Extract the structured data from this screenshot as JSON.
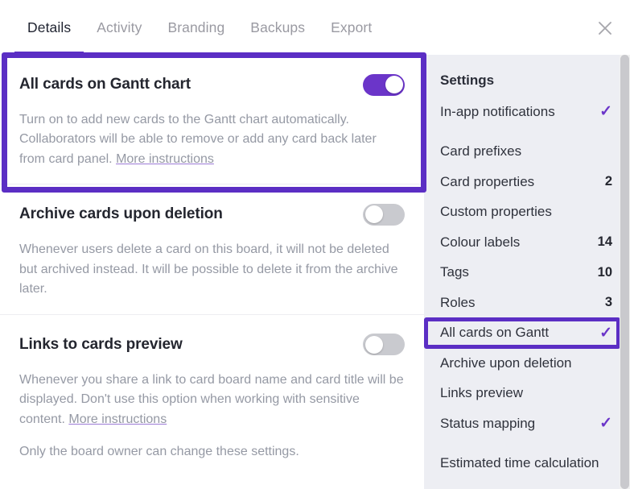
{
  "header": {
    "tabs": [
      {
        "label": "Details",
        "active": true
      },
      {
        "label": "Activity",
        "active": false
      },
      {
        "label": "Branding",
        "active": false
      },
      {
        "label": "Backups",
        "active": false
      },
      {
        "label": "Export",
        "active": false
      }
    ],
    "close_icon": "close-icon",
    "accent_color": "#5b2ec4"
  },
  "main": {
    "sections": [
      {
        "title": "All cards on Gantt chart",
        "body": "Turn on to add new cards to the Gantt chart automatically. Collaborators will be able to remove or add any card back later from card panel. ",
        "link": "More instructions",
        "toggle_state": "on",
        "highlighted": true
      },
      {
        "title": "Archive cards upon deletion",
        "body": "Whenever users delete a card on this board, it will not be deleted but archived instead. It will be possible to delete it from the archive later.",
        "link": "",
        "toggle_state": "off",
        "highlighted": false
      },
      {
        "title": "Links to cards preview",
        "body": "Whenever you share a link to card board name and card title will be displayed. Don't use this option when working with sensitive content. ",
        "link": "More instructions",
        "note": "Only the board owner can change these settings.",
        "toggle_state": "off",
        "highlighted": false
      }
    ]
  },
  "sidebar": {
    "heading": "Settings",
    "check_color": "#6b35c9",
    "items": [
      {
        "label": "In-app notifications",
        "check": "✓",
        "count": ""
      },
      {
        "label": "Card prefixes",
        "check": "",
        "count": "",
        "gap": true
      },
      {
        "label": "Card properties",
        "check": "",
        "count": "2"
      },
      {
        "label": "Custom properties",
        "check": "",
        "count": ""
      },
      {
        "label": "Colour labels",
        "check": "",
        "count": "14"
      },
      {
        "label": "Tags",
        "check": "",
        "count": "10"
      },
      {
        "label": "Roles",
        "check": "",
        "count": "3"
      },
      {
        "label": "All cards on Gantt",
        "check": "✓",
        "count": "",
        "highlighted": true
      },
      {
        "label": "Archive upon deletion",
        "check": "",
        "count": ""
      },
      {
        "label": "Links preview",
        "check": "",
        "count": ""
      },
      {
        "label": "Status mapping",
        "check": "✓",
        "count": ""
      },
      {
        "label": "Estimated time calculation",
        "check": "",
        "count": "",
        "gap": true
      }
    ]
  }
}
